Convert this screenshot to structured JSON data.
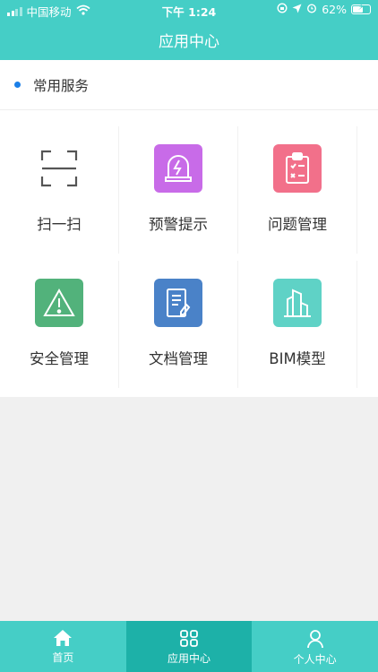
{
  "status_bar": {
    "carrier": "中国移动",
    "time": "下午 1:24",
    "battery": "62%",
    "battery_level": 0.62
  },
  "header": {
    "title": "应用中心"
  },
  "section": {
    "title": "常用服务"
  },
  "apps": [
    {
      "label": "扫一扫",
      "icon": "scan-icon",
      "color": ""
    },
    {
      "label": "预警提示",
      "icon": "alarm-icon",
      "color": "#c86be8"
    },
    {
      "label": "问题管理",
      "icon": "clipboard-icon",
      "color": "#f2708a"
    },
    {
      "label": "安全管理",
      "icon": "warning-icon",
      "color": "#52b27b"
    },
    {
      "label": "文档管理",
      "icon": "document-icon",
      "color": "#4a82c8"
    },
    {
      "label": "BIM模型",
      "icon": "building-icon",
      "color": "#5fd2c6"
    }
  ],
  "tabbar": [
    {
      "label": "首页",
      "icon": "home-icon",
      "active": false
    },
    {
      "label": "应用中心",
      "icon": "apps-icon",
      "active": true
    },
    {
      "label": "个人中心",
      "icon": "person-icon",
      "active": false
    }
  ],
  "colors": {
    "brand": "#45cec6",
    "tab_active": "#1db1a8",
    "dot": "#1b7fe8"
  }
}
